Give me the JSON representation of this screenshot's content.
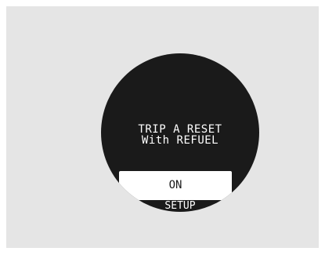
{
  "display": {
    "message_line1": "TRIP A RESET",
    "message_line2": "With REFUEL",
    "selected_option": "ON",
    "menu_label": "SETUP"
  },
  "colors": {
    "background": "#e5e5e5",
    "display": "#1a1a1a",
    "text_on_display": "#ffffff",
    "selection_box": "#ffffff"
  }
}
